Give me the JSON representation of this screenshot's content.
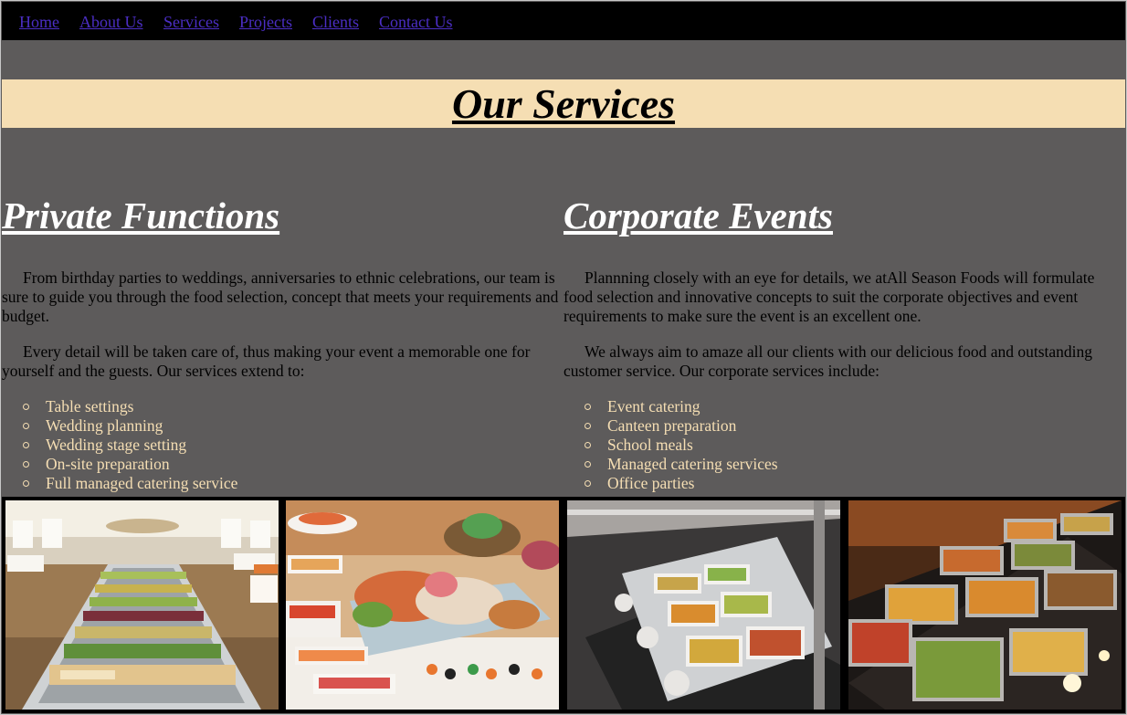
{
  "nav": {
    "items": [
      "Home",
      "About Us",
      "Services",
      "Projects",
      "Clients",
      "Contact Us"
    ]
  },
  "banner": {
    "title": "Our Services"
  },
  "private": {
    "heading": "Private Functions",
    "para1": "From birthday parties to weddings, anniversaries to ethnic celebrations, our team is sure to guide you through the food selection, concept that meets your requirements and budget.",
    "para2": "Every detail will be taken care of, thus making your event a memorable one for yourself and the guests. Our services extend to:",
    "items": [
      "Table settings",
      "Wedding planning",
      "Wedding stage setting",
      "On-site preparation",
      "Full managed catering service"
    ]
  },
  "corporate": {
    "heading": "Corporate Events",
    "para1": "Plannning closely with an eye for details, we atAll Season Foods will formulate food selection and innovative concepts to suit the corporate objectives and event requirements to make sure the event is an excellent one.",
    "para2": "We always aim to amaze all our clients with our delicious food and outstanding customer service. Our corporate services include:",
    "items": [
      "Event catering",
      "Canteen preparation",
      "School meals",
      "Managed catering services",
      "Office parties"
    ]
  },
  "colors": {
    "page_bg": "#5d5b5b",
    "nav_bg": "#000000",
    "link": "#4b2ec4",
    "banner_bg": "#f5deb3",
    "heading": "#ffffff",
    "list_text": "#f5deb3"
  }
}
